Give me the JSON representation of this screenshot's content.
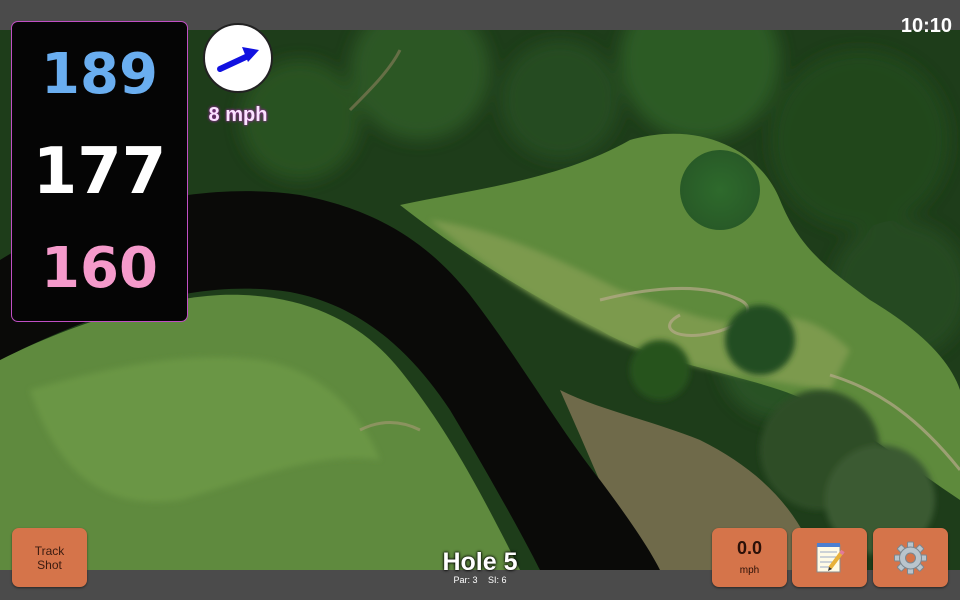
{
  "status_bar": {
    "time": "10:10"
  },
  "yardages": {
    "back": "189",
    "center": "177",
    "front": "160"
  },
  "wind": {
    "speed_label": "8 mph",
    "arrow_icon": "wind-arrow-icon",
    "arrow_color": "#1111e0"
  },
  "track_shot": {
    "line1": "Track",
    "line2": "Shot"
  },
  "speed_button": {
    "value": "0.0",
    "unit": "mph"
  },
  "notes_button": {
    "icon": "notepad-icon"
  },
  "settings_button": {
    "icon": "gear-icon"
  },
  "hole": {
    "title": "Hole 5",
    "par": "Par: 3",
    "si": "SI: 6"
  },
  "colors": {
    "accent_button": "#d5744a",
    "panel_border": "#c04fc4",
    "back_yard": "#6aaef0",
    "front_yard": "#f59acb"
  }
}
